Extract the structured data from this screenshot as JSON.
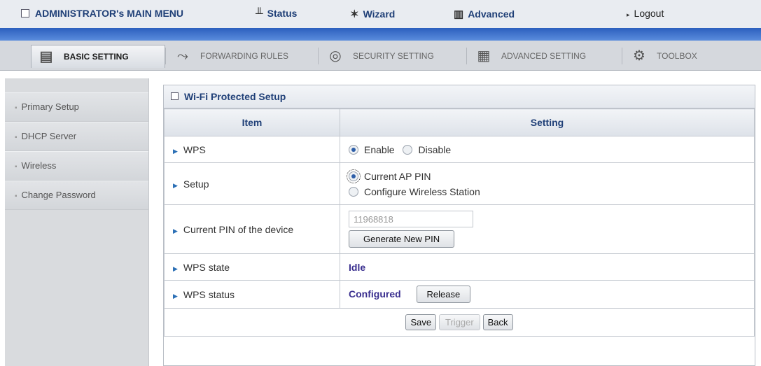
{
  "menu": {
    "title": "ADMINISTRATOR's MAIN MENU",
    "status": "Status",
    "wizard": "Wizard",
    "advanced": "Advanced",
    "logout": "Logout"
  },
  "tabs": {
    "basic": "BASIC SETTING",
    "forwarding": "FORWARDING RULES",
    "security": "SECURITY SETTING",
    "advanced": "ADVANCED SETTING",
    "toolbox": "TOOLBOX"
  },
  "sidebar": {
    "items": [
      {
        "label": "Primary Setup"
      },
      {
        "label": "DHCP Server"
      },
      {
        "label": "Wireless"
      },
      {
        "label": "Change Password"
      }
    ]
  },
  "panel": {
    "title": "Wi-Fi Protected Setup",
    "col_item": "Item",
    "col_setting": "Setting",
    "wps_label": "WPS",
    "wps_enable": "Enable",
    "wps_disable": "Disable",
    "setup_label": "Setup",
    "setup_opt1": "Current AP PIN",
    "setup_opt2": "Configure Wireless Station",
    "pin_label": "Current PIN of the device",
    "pin_value": "11968818",
    "generate_btn": "Generate New PIN",
    "state_label": "WPS state",
    "state_value": "Idle",
    "status_label": "WPS status",
    "status_value": "Configured",
    "release_btn": "Release",
    "save_btn": "Save",
    "trigger_btn": "Trigger",
    "back_btn": "Back"
  },
  "colors": {
    "accent": "#1f3f77",
    "value": "#3a2f8f",
    "band": "#2c5fbe"
  }
}
